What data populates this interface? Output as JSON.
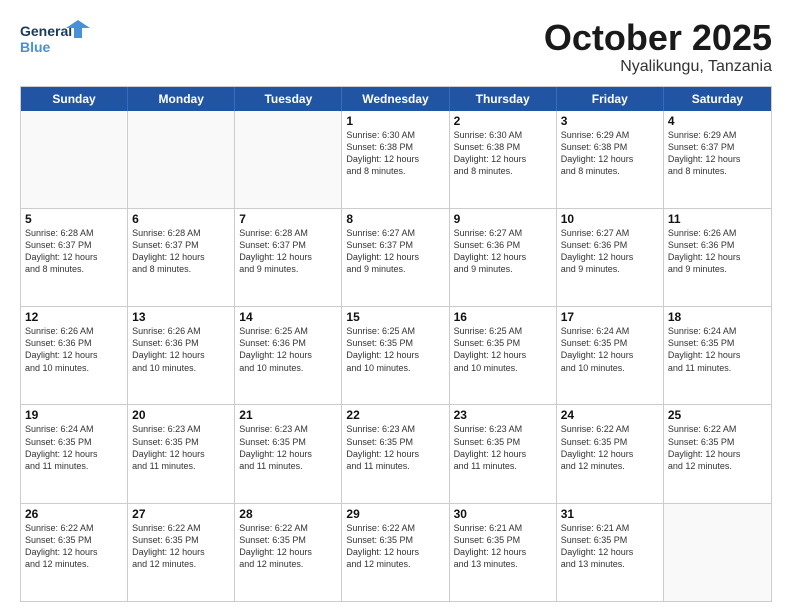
{
  "header": {
    "logo_line1": "General",
    "logo_line2": "Blue",
    "month": "October 2025",
    "location": "Nyalikungu, Tanzania"
  },
  "weekdays": [
    "Sunday",
    "Monday",
    "Tuesday",
    "Wednesday",
    "Thursday",
    "Friday",
    "Saturday"
  ],
  "rows": [
    [
      {
        "day": "",
        "info": ""
      },
      {
        "day": "",
        "info": ""
      },
      {
        "day": "",
        "info": ""
      },
      {
        "day": "1",
        "info": "Sunrise: 6:30 AM\nSunset: 6:38 PM\nDaylight: 12 hours\nand 8 minutes."
      },
      {
        "day": "2",
        "info": "Sunrise: 6:30 AM\nSunset: 6:38 PM\nDaylight: 12 hours\nand 8 minutes."
      },
      {
        "day": "3",
        "info": "Sunrise: 6:29 AM\nSunset: 6:38 PM\nDaylight: 12 hours\nand 8 minutes."
      },
      {
        "day": "4",
        "info": "Sunrise: 6:29 AM\nSunset: 6:37 PM\nDaylight: 12 hours\nand 8 minutes."
      }
    ],
    [
      {
        "day": "5",
        "info": "Sunrise: 6:28 AM\nSunset: 6:37 PM\nDaylight: 12 hours\nand 8 minutes."
      },
      {
        "day": "6",
        "info": "Sunrise: 6:28 AM\nSunset: 6:37 PM\nDaylight: 12 hours\nand 8 minutes."
      },
      {
        "day": "7",
        "info": "Sunrise: 6:28 AM\nSunset: 6:37 PM\nDaylight: 12 hours\nand 9 minutes."
      },
      {
        "day": "8",
        "info": "Sunrise: 6:27 AM\nSunset: 6:37 PM\nDaylight: 12 hours\nand 9 minutes."
      },
      {
        "day": "9",
        "info": "Sunrise: 6:27 AM\nSunset: 6:36 PM\nDaylight: 12 hours\nand 9 minutes."
      },
      {
        "day": "10",
        "info": "Sunrise: 6:27 AM\nSunset: 6:36 PM\nDaylight: 12 hours\nand 9 minutes."
      },
      {
        "day": "11",
        "info": "Sunrise: 6:26 AM\nSunset: 6:36 PM\nDaylight: 12 hours\nand 9 minutes."
      }
    ],
    [
      {
        "day": "12",
        "info": "Sunrise: 6:26 AM\nSunset: 6:36 PM\nDaylight: 12 hours\nand 10 minutes."
      },
      {
        "day": "13",
        "info": "Sunrise: 6:26 AM\nSunset: 6:36 PM\nDaylight: 12 hours\nand 10 minutes."
      },
      {
        "day": "14",
        "info": "Sunrise: 6:25 AM\nSunset: 6:36 PM\nDaylight: 12 hours\nand 10 minutes."
      },
      {
        "day": "15",
        "info": "Sunrise: 6:25 AM\nSunset: 6:35 PM\nDaylight: 12 hours\nand 10 minutes."
      },
      {
        "day": "16",
        "info": "Sunrise: 6:25 AM\nSunset: 6:35 PM\nDaylight: 12 hours\nand 10 minutes."
      },
      {
        "day": "17",
        "info": "Sunrise: 6:24 AM\nSunset: 6:35 PM\nDaylight: 12 hours\nand 10 minutes."
      },
      {
        "day": "18",
        "info": "Sunrise: 6:24 AM\nSunset: 6:35 PM\nDaylight: 12 hours\nand 11 minutes."
      }
    ],
    [
      {
        "day": "19",
        "info": "Sunrise: 6:24 AM\nSunset: 6:35 PM\nDaylight: 12 hours\nand 11 minutes."
      },
      {
        "day": "20",
        "info": "Sunrise: 6:23 AM\nSunset: 6:35 PM\nDaylight: 12 hours\nand 11 minutes."
      },
      {
        "day": "21",
        "info": "Sunrise: 6:23 AM\nSunset: 6:35 PM\nDaylight: 12 hours\nand 11 minutes."
      },
      {
        "day": "22",
        "info": "Sunrise: 6:23 AM\nSunset: 6:35 PM\nDaylight: 12 hours\nand 11 minutes."
      },
      {
        "day": "23",
        "info": "Sunrise: 6:23 AM\nSunset: 6:35 PM\nDaylight: 12 hours\nand 11 minutes."
      },
      {
        "day": "24",
        "info": "Sunrise: 6:22 AM\nSunset: 6:35 PM\nDaylight: 12 hours\nand 12 minutes."
      },
      {
        "day": "25",
        "info": "Sunrise: 6:22 AM\nSunset: 6:35 PM\nDaylight: 12 hours\nand 12 minutes."
      }
    ],
    [
      {
        "day": "26",
        "info": "Sunrise: 6:22 AM\nSunset: 6:35 PM\nDaylight: 12 hours\nand 12 minutes."
      },
      {
        "day": "27",
        "info": "Sunrise: 6:22 AM\nSunset: 6:35 PM\nDaylight: 12 hours\nand 12 minutes."
      },
      {
        "day": "28",
        "info": "Sunrise: 6:22 AM\nSunset: 6:35 PM\nDaylight: 12 hours\nand 12 minutes."
      },
      {
        "day": "29",
        "info": "Sunrise: 6:22 AM\nSunset: 6:35 PM\nDaylight: 12 hours\nand 12 minutes."
      },
      {
        "day": "30",
        "info": "Sunrise: 6:21 AM\nSunset: 6:35 PM\nDaylight: 12 hours\nand 13 minutes."
      },
      {
        "day": "31",
        "info": "Sunrise: 6:21 AM\nSunset: 6:35 PM\nDaylight: 12 hours\nand 13 minutes."
      },
      {
        "day": "",
        "info": ""
      }
    ]
  ]
}
